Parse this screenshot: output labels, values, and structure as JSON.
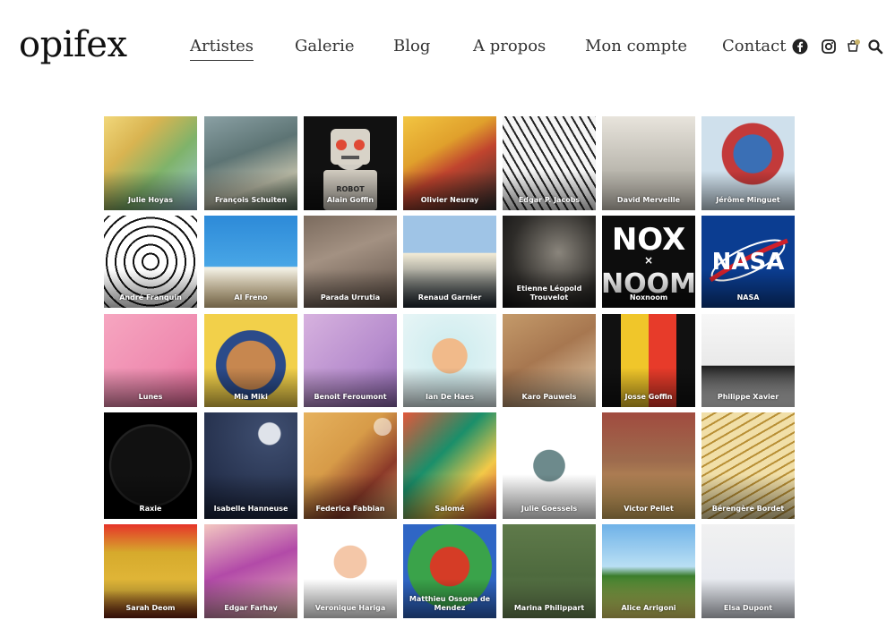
{
  "brand": {
    "logo": "opifex"
  },
  "nav": {
    "items": [
      {
        "label": "Artistes",
        "active": true
      },
      {
        "label": "Galerie"
      },
      {
        "label": "Blog"
      },
      {
        "label": "A propos"
      },
      {
        "label": "Mon compte"
      },
      {
        "label": "Contact"
      }
    ]
  },
  "header_icons": [
    "facebook-icon",
    "instagram-icon",
    "cart-icon",
    "search-icon"
  ],
  "colors": {
    "text": "#333333",
    "background": "#ffffff"
  },
  "artists": [
    [
      "Julie Hoyas",
      "François Schuiten",
      "Alain Goffin",
      "Olivier Neuray",
      "Edgar P. Jacobs",
      "David Merveille",
      "Jérôme Minguet"
    ],
    [
      "André Franquin",
      "Al Freno",
      "Parada Urrutia",
      "Renaud Garnier",
      "Etienne Léopold Trouvelot",
      "Noxnoom",
      "NASA"
    ],
    [
      "Lunes",
      "Mia Miki",
      "Benoit Feroumont",
      "Ian De Haes",
      "Karo Pauwels",
      "Josse Goffin",
      "Philippe Xavier"
    ],
    [
      "Raxie",
      "Isabelle Hanneuse",
      "Federica Fabbian",
      "Salomé",
      "Julie Goessels",
      "Victor Pellet",
      "Bérengère Bordet"
    ],
    [
      "Sarah Deom",
      "Edgar Farhay",
      "Veronique Hariga",
      "Matthieu Ossona de Mendez",
      "Marina Philippart",
      "Alice Arrigoni",
      "Elsa Dupont"
    ]
  ],
  "tile_art": {
    "Julie Hoyas": "julie-hoyas",
    "Noxnoom": "noxnoom",
    "NASA": "nasa"
  },
  "tile_text": {
    "Noxnoom_top": "NOX",
    "Noxnoom_mid": "×",
    "Noxnoom_bot": "NOOM",
    "NASA_word": "NASA",
    "Alain Goffin_robot": "ROBOT"
  }
}
